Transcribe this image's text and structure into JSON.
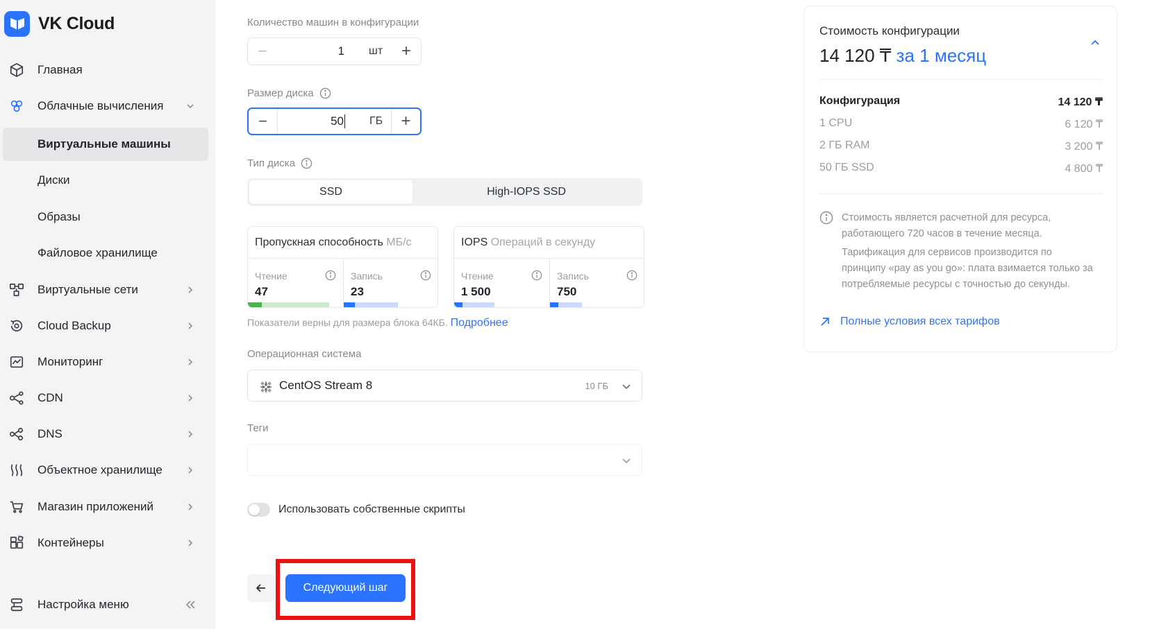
{
  "app": {
    "logo_text": "VK Cloud"
  },
  "sidebar": {
    "items": [
      {
        "label": "Главная",
        "icon": "cube-icon"
      },
      {
        "label": "Облачные вычисления",
        "icon": "cloud-compute-icon"
      },
      {
        "label": "Виртуальные машины",
        "active": true
      },
      {
        "label": "Диски"
      },
      {
        "label": "Образы"
      },
      {
        "label": "Файловое хранилище"
      },
      {
        "label": "Виртуальные сети",
        "icon": "network-icon"
      },
      {
        "label": "Cloud Backup",
        "icon": "backup-icon"
      },
      {
        "label": "Мониторинг",
        "icon": "monitoring-icon"
      },
      {
        "label": "CDN",
        "icon": "cdn-icon"
      },
      {
        "label": "DNS",
        "icon": "dns-icon"
      },
      {
        "label": "Объектное хранилище",
        "icon": "object-storage-icon"
      },
      {
        "label": "Магазин приложений",
        "icon": "cart-icon"
      },
      {
        "label": "Контейнеры",
        "icon": "containers-icon"
      }
    ],
    "menu_settings": "Настройка меню"
  },
  "form": {
    "machines_label": "Количество машин в конфигурации",
    "machines_value": "1",
    "machines_unit": "шт",
    "disk_size_label": "Размер диска",
    "disk_size_value": "50",
    "disk_size_unit": "ГБ",
    "disk_type_label": "Тип диска",
    "disk_types": [
      "SSD",
      "High-IOPS SSD"
    ],
    "disk_type_selected": "SSD",
    "throughput": {
      "title": "Пропускная способность",
      "unit": "МБ/с",
      "read_label": "Чтение",
      "read_value": "47",
      "write_label": "Запись",
      "write_value": "23"
    },
    "iops": {
      "title": "IOPS",
      "unit": "Операций в секунду",
      "read_label": "Чтение",
      "read_value": "1 500",
      "write_label": "Запись",
      "write_value": "750"
    },
    "perf_note": "Показатели верны для размера блока 64КБ.",
    "perf_note_link": "Подробнее",
    "os_label": "Операционная система",
    "os_value": "CentOS Stream 8",
    "os_size": "10 ГБ",
    "tags_label": "Теги",
    "scripts_toggle_label": "Использовать собственные скрипты",
    "next_button": "Следующий шаг"
  },
  "price": {
    "title": "Стоимость конфигурации",
    "total": "14 120 ₸",
    "period": "за 1 месяц",
    "header_label": "Конфигурация",
    "header_value": "14 120 ₸",
    "rows": [
      {
        "label": "1 CPU",
        "value": "6 120 ₸"
      },
      {
        "label": "2 ГБ RAM",
        "value": "3 200 ₸"
      },
      {
        "label": "50 ГБ SSD",
        "value": "4 800 ₸"
      }
    ],
    "info_1": "Стоимость является расчетной для ресурса, работающего 720 часов в течение месяца.",
    "info_2": "Тарификация для сервисов производится по принципу «pay as you go»: плата взимается только за потребляемые ресурсы с точностью до секунды.",
    "link": "Полные условия всех тарифов"
  },
  "colors": {
    "accent": "#2a73ff",
    "read_throughput_bar": "#4caf50",
    "highlight_frame": "#ee1111"
  }
}
